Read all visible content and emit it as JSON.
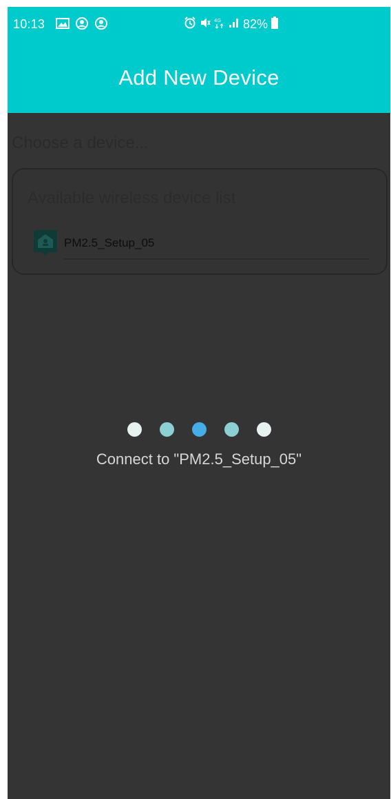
{
  "status_bar": {
    "time": "10:13",
    "battery": "82%",
    "left_icons": [
      "gallery-icon",
      "account-sync-icon",
      "account-sync-icon"
    ],
    "right_icons": [
      "alarm-icon",
      "mute-icon",
      "lte-icon",
      "signal-icon",
      "battery-icon"
    ]
  },
  "appbar": {
    "title": "Add New Device"
  },
  "content": {
    "choose_label": "Choose a device...",
    "card_title": "Available wireless device list",
    "devices": [
      {
        "name": "PM2.5_Setup_05",
        "icon": "device-icon"
      }
    ]
  },
  "loader": {
    "dot_colors": [
      "#e6f2f0",
      "#8dd0d4",
      "#45aee6",
      "#8dd0d4",
      "#e6f2f0"
    ],
    "message": "Connect to \"PM2.5_Setup_05\""
  },
  "colors": {
    "accent": "#00cbcc",
    "overlay": "#343434"
  }
}
